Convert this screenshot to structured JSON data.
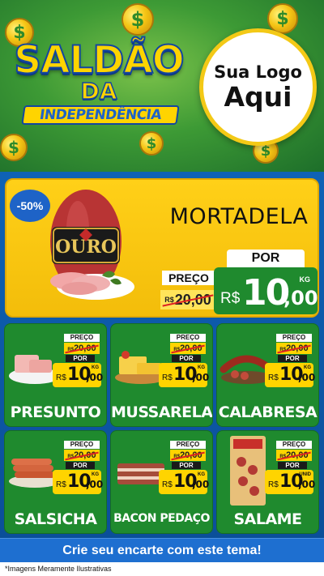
{
  "header": {
    "title_line1": "SALDÃO",
    "title_line2": "DA",
    "title_line3": "INDEPENDÊNCIA",
    "logo_line1": "Sua Logo",
    "logo_line2": "Aqui",
    "coin_glyph": "$"
  },
  "hero": {
    "discount": "-50%",
    "product": "MORTADELA",
    "brand": "OURO",
    "preco_label": "PREÇO",
    "old_price_currency": "R$",
    "old_price": "20,00",
    "por_label": "POR",
    "currency": "R$",
    "price_int": "10",
    "price_dec": ",00",
    "unit": "KG"
  },
  "products": [
    {
      "name": "PRESUNTO",
      "preco_label": "PREÇO",
      "old_currency": "R$",
      "old_price": "20,00",
      "por_label": "POR",
      "currency": "R$",
      "price_int": "10",
      "price_dec": ",00",
      "unit": "KG"
    },
    {
      "name": "MUSSARELA",
      "preco_label": "PREÇO",
      "old_currency": "R$",
      "old_price": "20,00",
      "por_label": "POR",
      "currency": "R$",
      "price_int": "10",
      "price_dec": ",00",
      "unit": "KG"
    },
    {
      "name": "CALABRESA",
      "preco_label": "PREÇO",
      "old_currency": "R$",
      "old_price": "20,00",
      "por_label": "POR",
      "currency": "R$",
      "price_int": "10",
      "price_dec": ",00",
      "unit": "KG"
    },
    {
      "name": "SALSICHA",
      "preco_label": "PREÇO",
      "old_currency": "R$",
      "old_price": "20,00",
      "por_label": "POR",
      "currency": "R$",
      "price_int": "10",
      "price_dec": ",00",
      "unit": "KG"
    },
    {
      "name": "BACON PEDAÇO",
      "preco_label": "PREÇO",
      "old_currency": "R$",
      "old_price": "20,00",
      "por_label": "POR",
      "currency": "R$",
      "price_int": "10",
      "price_dec": ",00",
      "unit": "KG"
    },
    {
      "name": "SALAME",
      "preco_label": "PREÇO",
      "old_currency": "R$",
      "old_price": "20,00",
      "por_label": "POR",
      "currency": "R$",
      "price_int": "10",
      "price_dec": ",00",
      "unit": "UNID"
    }
  ],
  "cta": {
    "label": "Crie seu encarte com este tema!"
  },
  "footer": {
    "note": "*Imagens Meramente Ilustrativas"
  },
  "colors": {
    "green": "#1f8a2e",
    "yellow": "#ffd400",
    "blue": "#0f62b5",
    "cta_blue": "#1e6fd0"
  }
}
